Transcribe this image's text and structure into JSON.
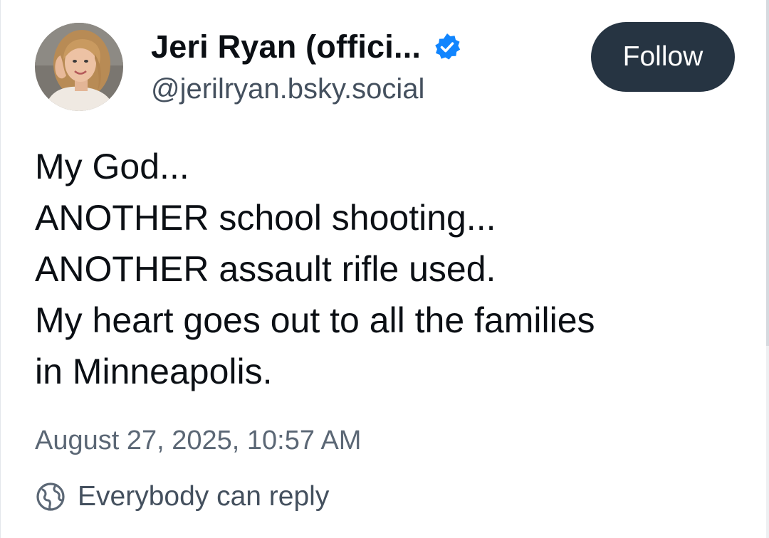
{
  "author": {
    "display_name": "Jeri Ryan (offici...",
    "handle": "@jerilryan.bsky.social",
    "verified": true,
    "avatar_icon": "profile-photo"
  },
  "follow_button": {
    "label": "Follow"
  },
  "post": {
    "lines": [
      "My God...",
      "ANOTHER school shooting...",
      "ANOTHER assault rifle used.",
      "My heart goes out to all the families",
      "in Minneapolis."
    ],
    "timestamp": "August 27, 2025, 10:57 AM"
  },
  "reply_settings": {
    "icon": "globe-icon",
    "label": "Everybody can reply"
  },
  "colors": {
    "follow_bg": "#263442",
    "verified_blue": "#1185fe",
    "text_primary": "#0b0f14",
    "text_secondary": "#44505e"
  }
}
